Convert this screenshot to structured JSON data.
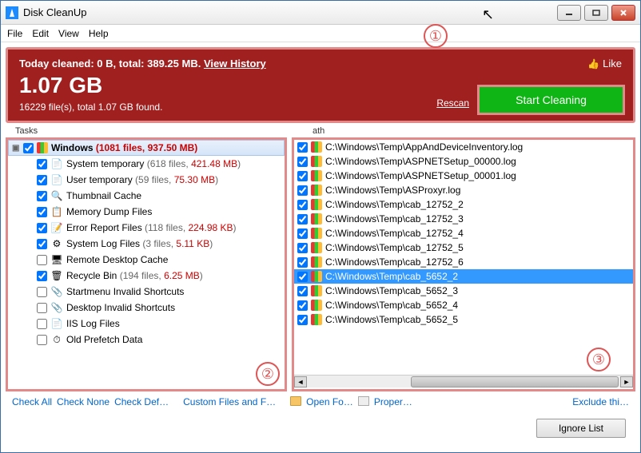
{
  "title": "Disk CleanUp",
  "menu": [
    "File",
    "Edit",
    "View",
    "Help"
  ],
  "header": {
    "summary_prefix": "Today cleaned: 0 B, total: 389.25 MB. ",
    "history_link": "View History",
    "size": "1.07 GB",
    "files_line": "16229 file(s), total 1.07 GB found.",
    "like": "Like",
    "rescan": "Rescan",
    "start": "Start Cleaning"
  },
  "annotations": {
    "a1": "①",
    "a2": "②",
    "a3": "③"
  },
  "section_tasks": "Tasks",
  "section_path": "ath",
  "root": {
    "name": "Windows",
    "stats": "(1081 files, 937.50 MB)"
  },
  "tasks": [
    {
      "name": "System temporary",
      "files": "618",
      "size": "421.48 MB",
      "checked": true,
      "icon": "📄"
    },
    {
      "name": "User temporary",
      "files": "59",
      "size": "75.30 MB",
      "checked": true,
      "icon": "📄"
    },
    {
      "name": "Thumbnail Cache",
      "checked": true,
      "icon": "🔍"
    },
    {
      "name": "Memory Dump Files",
      "checked": true,
      "icon": "📋"
    },
    {
      "name": "Error Report Files",
      "files": "118",
      "size": "224.98 KB",
      "checked": true,
      "icon": "📝"
    },
    {
      "name": "System Log Files",
      "files": "3",
      "size": "5.11 KB",
      "checked": true,
      "icon": "⚙"
    },
    {
      "name": "Remote Desktop Cache",
      "checked": false,
      "icon": "🖥"
    },
    {
      "name": "Recycle Bin",
      "files": "194",
      "size": "6.25 MB",
      "checked": true,
      "icon": "🗑"
    },
    {
      "name": "Startmenu Invalid Shortcuts",
      "checked": false,
      "icon": "📎"
    },
    {
      "name": "Desktop Invalid Shortcuts",
      "checked": false,
      "icon": "📎"
    },
    {
      "name": "IIS Log Files",
      "checked": false,
      "icon": "📄"
    },
    {
      "name": "Old Prefetch Data",
      "checked": false,
      "icon": "⏱"
    }
  ],
  "paths": [
    {
      "p": "C:\\Windows\\Temp\\AppAndDeviceInventory.log",
      "sel": false
    },
    {
      "p": "C:\\Windows\\Temp\\ASPNETSetup_00000.log",
      "sel": false
    },
    {
      "p": "C:\\Windows\\Temp\\ASPNETSetup_00001.log",
      "sel": false
    },
    {
      "p": "C:\\Windows\\Temp\\ASProxyr.log",
      "sel": false
    },
    {
      "p": "C:\\Windows\\Temp\\cab_12752_2",
      "sel": false
    },
    {
      "p": "C:\\Windows\\Temp\\cab_12752_3",
      "sel": false
    },
    {
      "p": "C:\\Windows\\Temp\\cab_12752_4",
      "sel": false
    },
    {
      "p": "C:\\Windows\\Temp\\cab_12752_5",
      "sel": false
    },
    {
      "p": "C:\\Windows\\Temp\\cab_12752_6",
      "sel": false
    },
    {
      "p": "C:\\Windows\\Temp\\cab_5652_2",
      "sel": true
    },
    {
      "p": "C:\\Windows\\Temp\\cab_5652_3",
      "sel": false
    },
    {
      "p": "C:\\Windows\\Temp\\cab_5652_4",
      "sel": false
    },
    {
      "p": "C:\\Windows\\Temp\\cab_5652_5",
      "sel": false
    }
  ],
  "links": {
    "check_all": "Check All",
    "check_none": "Check None",
    "check_def": "Check Def…",
    "custom": "Custom Files and F…",
    "open": "Open Fo…",
    "proper": "Proper…",
    "exclude": "Exclude thi…"
  },
  "footer_btn": "Ignore List"
}
